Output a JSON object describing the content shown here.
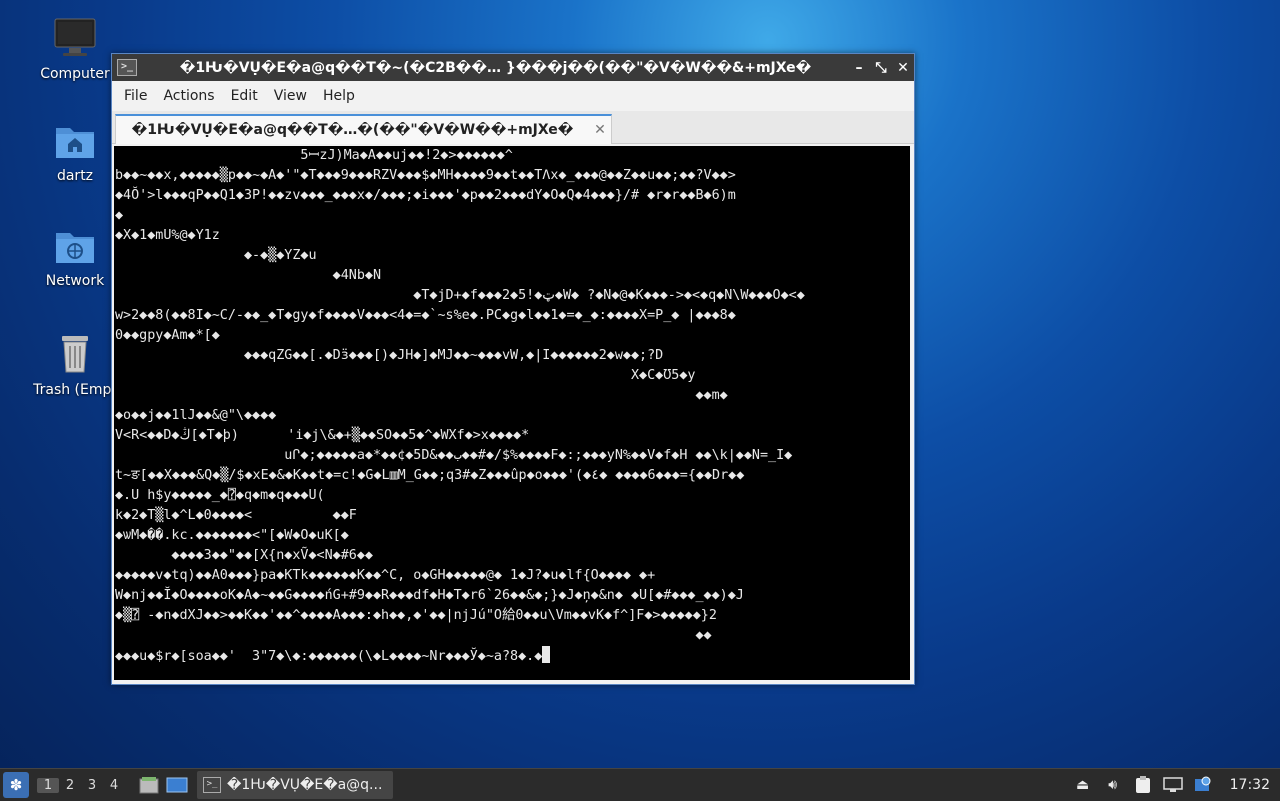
{
  "desktop": {
    "icons": [
      {
        "label": "Computer",
        "icon": "monitor-icon"
      },
      {
        "label": "dartz",
        "icon": "home-folder-icon"
      },
      {
        "label": "Network",
        "icon": "network-folder-icon"
      },
      {
        "label": "Trash (Empt",
        "icon": "trash-icon"
      }
    ]
  },
  "window": {
    "title": "�1Ƕ�VỤ�E�a@q��T�~(�C2B��… }���j��(��\"�V�W��&+mЈXe�",
    "controls": {
      "minimize": "–",
      "maximize": "⤡",
      "close": "✕"
    },
    "menu": [
      "File",
      "Actions",
      "Edit",
      "View",
      "Help"
    ],
    "tab": {
      "title": "�1Ƕ�VỤ�E�a@q��T�…�(��\"�V�W��+mЈXe�",
      "close": "✕"
    },
    "terminal_lines": [
      "                       5ꟷzJ)Ma◆A◆◆uj◆◆!2◆>◆◆◆◆◆◆^",
      "b◆◆~◆◆x,◆◆◆◆◆▒p◆◆~◆A◆'\"◆T◆◆◆9◆◆◆RZV◆◆◆$◆MH◆◆◆◆9◆◆t◆◆TΛx◆_◆◆◆@◆◆Z◆◆u◆◆;◆◆?V◆◆>",
      "◆4Ŏ'>l◆◆◆qP◆◆Q1◆3P!◆◆zv◆◆◆_◆◆◆x◆/◆◆◆;◆i◆◆◆'◆p◆◆2◆◆◆dY◆O◆Q◆4◆◆◆}/# ◆r◆r◆◆B◆6)m",
      "◆",
      "◆X◆1◆mU%@◆Y1z",
      "                ◆-◆▒◆YZ◆u",
      "                           ◆4Nb◆N",
      "                                     ◆T◆jD+◆f◆◆◆2◆5!◆ټ◆W◆ ?◆N◆@◆K◆◆◆->◆<◆q◆N\\W◆◆◆O◆<◆",
      "w>2◆◆8(◆◆8I◆~C/-◆◆_◆T◆gy◆f◆◆◆◆V◆◆◆<4◆=◆`~s%e◆.PC◆g◆l◆◆1◆=◆_◆:◆◆◆◆X=P_◆ |◆◆◆8◆",
      "0◆◆gpy◆Am◆*[◆",
      "                ◆◆◆qZG◆◆[.◆Dӟ◆◆◆[)◆JH◆]◆MJ◆◆~◆◆◆vW,◆|I◆◆◆◆◆◆2◆w◆◆;?D",
      "                                                                X◆C◆Ʊ5◆y",
      "                                                                        ◆◆m◆",
      "◆o◆◆j◆◆1lJ◆◆&@\"\\◆◆◆◆",
      "V<R<◆◆D◆ڭ[◆T◆þ)      'i◆j\\&◆+▒◆◆SO◆◆5◆^◆WXf◆>x◆◆◆◆*",
      "                     uՐ◆;◆◆◆◆◆a◆*◆◆¢◆5D&◆◆ب◆◆#◆/$%◆◆◆◆F◆:;◆◆◆yN%◆◆V◆f◆H ◆◆\\k|◆◆N=_I◆",
      "t~ङ[◆◆X◆◆◆&Q◆▒/$◆xE◆&◆K◆◆t◆=c!◆G◆L▥M_G◆◆;q3#◆Z◆◆◆ûp◆o◆◆◆'(◆٤◆ ◆◆◆◆6◆◆◆={◆◆Dr◆◆",
      "◆.U h$y◆◆◆◆◆_◆⍰◆q◆m◆q◆◆◆U(",
      "k◆2◆T▒l◆^L◆0◆◆◆◆<          ◆◆F",
      "◆ѡM◆��.kc.◆◆◆◆◆◆◆<\"[◆W◆O◆uK[◆",
      "       ◆◆◆◆3◆◆\"◆◆[X{n◆xṼ◆<N◆#6◆◆",
      "◆◆◆◆◆v◆tq)◆◆A0◆◆◆}pa◆KTk◆◆◆◆◆◆K◆◆^C, o◆GH◆◆◆◆◆@◆ 1◆J?◆u◆lf{O◆◆◆◆ ◆+",
      "W◆nj◆◆Ĭ◆O◆◆◆◆oK◆A◆~◆◆G◆◆◆◆ńG+#9◆◆R◆◆◆df◆H◆T◆r6`26◆◆&◆;}◆J◆ņ◆&n◆ ◆U[◆#◆◆◆_◆◆)◆J",
      "◆▒⍰ -◆n◆dXJ◆◆>◆◆K◆◆'◆◆^◆◆◆◆A◆◆◆:◆h◆◆,◆'◆◆|njJú\"O給0◆◆u\\Vm◆◆vK◆f^]F◆>◆◆◆◆◆}2",
      "                                                                        ◆◆",
      "◆◆◆u◆$r◆[soa◆◆'  3\"7◆\\◆:◆◆◆◆◆◆(\\◆L◆◆◆◆~Nr◆◆◆Ў◆~a?8◆.◆"
    ]
  },
  "taskbar": {
    "workspaces": [
      "1",
      "2",
      "3",
      "4"
    ],
    "active_workspace": "1",
    "task_label": "�1Ƕ�VỤ�E�a@q...",
    "clock": "17:32"
  }
}
